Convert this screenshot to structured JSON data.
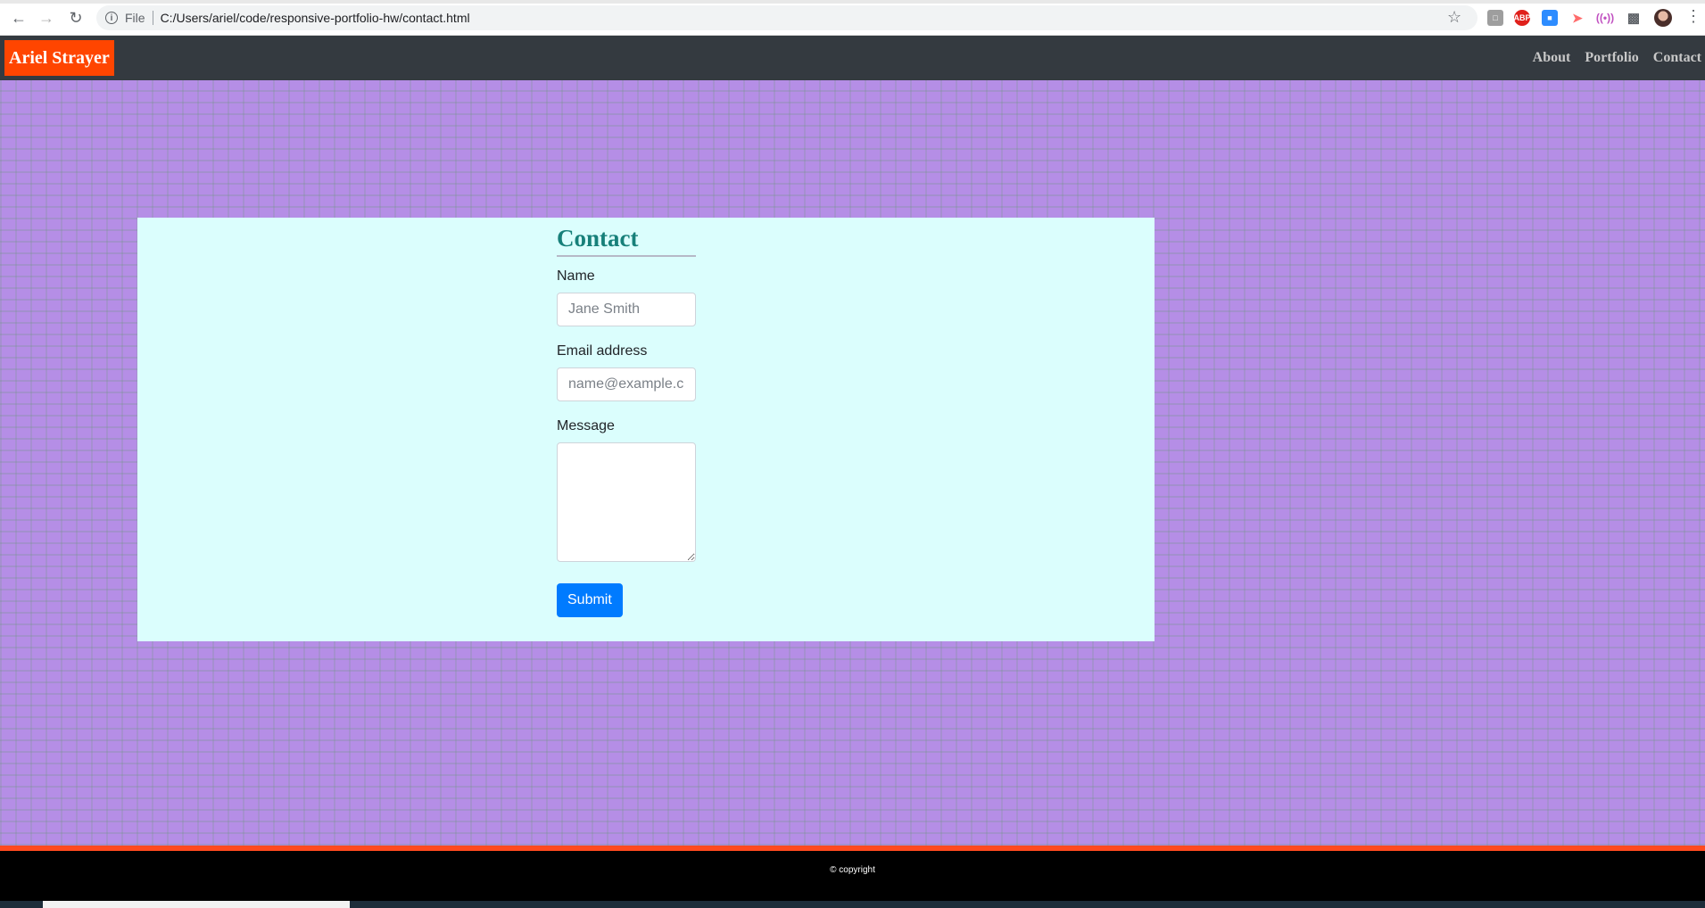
{
  "browser": {
    "file_label": "File",
    "url": "C:/Users/ariel/code/responsive-portfolio-hw/contact.html",
    "extensions": [
      "pdf-icon",
      "adblock-icon",
      "zoom-icon",
      "screencast-icon",
      "podcast-icon",
      "puzzle-icon"
    ],
    "abp_label": "ABP"
  },
  "site": {
    "brand": "Ariel Strayer",
    "brand_color": "#ff4500",
    "nav": [
      "About",
      "Portfolio",
      "Contact"
    ]
  },
  "contact": {
    "title": "Contact",
    "name_label": "Name",
    "name_placeholder": "Jane Smith",
    "email_label": "Email address",
    "email_placeholder": "name@example.com",
    "message_label": "Message",
    "submit_label": "Submit"
  },
  "footer": {
    "copyright": "© copyright"
  },
  "colors": {
    "background": "#b58ee6",
    "card": "#dbfefd",
    "title": "#17807a",
    "button": "#007bff",
    "footer_accent": "#ff4a1f"
  }
}
